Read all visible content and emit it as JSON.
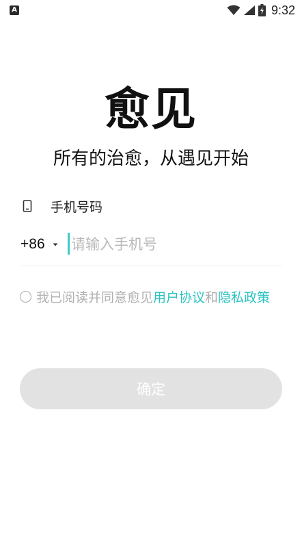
{
  "status_bar": {
    "notification_icon": "A",
    "icons": [
      "wifi-icon",
      "signal-icon",
      "battery-charging-icon"
    ],
    "time": "9:32"
  },
  "brand": {
    "title": "愈见",
    "slogan": "所有的治愈，从遇见开始"
  },
  "login": {
    "section_label": "手机号码",
    "country_code": "+86",
    "phone_placeholder": "请输入手机号",
    "phone_value": ""
  },
  "agreement": {
    "prefix": "我已阅读并同意愈见",
    "user_agreement": "用户协议",
    "conjunction": "和",
    "privacy_policy": "隐私政策",
    "checked": false
  },
  "actions": {
    "confirm_label": "确定"
  },
  "colors": {
    "accent": "#2bc2c2",
    "cursor": "#3cc9c9",
    "button_disabled_bg": "#e2e2e2",
    "placeholder": "#b9b9b9",
    "muted_text": "#b0b0b0"
  }
}
